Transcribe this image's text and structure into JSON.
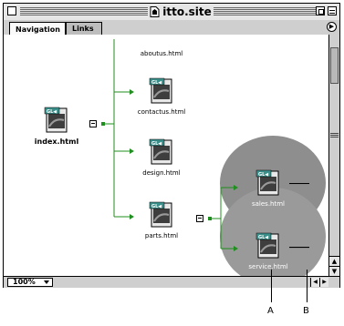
{
  "window": {
    "title": "itto.site"
  },
  "tabs": [
    {
      "label": "Navigation",
      "active": true
    },
    {
      "label": "Links",
      "active": false
    }
  ],
  "nodes": {
    "index": "index.html",
    "aboutus": "aboutus.html",
    "contactus": "contactus.html",
    "design": "design.html",
    "parts": "parts.html",
    "sales": "sales.html",
    "service": "service.html"
  },
  "status": {
    "zoom": "100%"
  },
  "callouts": {
    "a": "A",
    "b": "B"
  },
  "colors": {
    "link_line": "#1f8f1f",
    "selection_blob": "#8e8e8e",
    "window_chrome": "#cfcfcf"
  },
  "icons": {
    "file": "html-file-icon",
    "site": "site-file-icon"
  }
}
